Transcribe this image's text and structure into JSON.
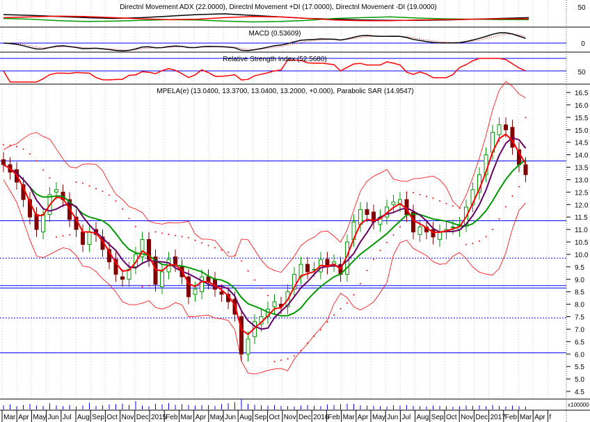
{
  "chart_data": {
    "type": "candlestick",
    "title": "MPELA(e) (13.0400, 13.3700, 13.0400, 13.2000, +0.000), Parabolic SAR (14.9547)",
    "panels": {
      "adx_title": "Directnl Movement ADX (22.0000), Directnl Movement +DI (17.0000), Directnl Movement -DI (19.0000)",
      "macd_title": "MACD (0.53609)",
      "rsi_title": "Relative Strength Index (52.5680)",
      "adx_axis_label": "50",
      "macd_axis_label": "0",
      "rsi_axis_label": "50",
      "volume_axis_label": "x100000"
    },
    "price_ylim": [
      4.5,
      16.5
    ],
    "price_ticks": [
      "16.5",
      "16.0",
      "15.5",
      "15.0",
      "14.5",
      "14.0",
      "13.5",
      "13.0",
      "12.5",
      "12.0",
      "11.5",
      "11.0",
      "10.5",
      "10.0",
      "9.5",
      "9.0",
      "8.5",
      "8.0",
      "7.5",
      "7.0",
      "6.5",
      "6.0",
      "5.5",
      "5.0",
      "4.5"
    ],
    "x_labels": [
      "Mar",
      "Apr",
      "May",
      "Jun",
      "Jul",
      "Aug",
      "Sep",
      "Oct",
      "Nov",
      "Dec",
      "2015",
      "Feb",
      "Mar",
      "Apr",
      "May",
      "Jun",
      "Aug",
      "Sep",
      "Oct",
      "Nov",
      "Dec",
      "2016",
      "Feb",
      "Mar",
      "Apr",
      "May",
      "Jun",
      "Jul",
      "Aug",
      "Sep",
      "Oct",
      "Nov",
      "Dec",
      "2017",
      "Feb",
      "Mar",
      "Apr",
      "f"
    ],
    "closes": [
      13.6,
      13.3,
      12.9,
      12.2,
      11.5,
      11.0,
      11.6,
      12.4,
      12.6,
      12.2,
      11.4,
      11.0,
      10.4,
      10.9,
      10.8,
      10.2,
      9.7,
      9.2,
      9.0,
      9.4,
      10.0,
      10.6,
      9.8,
      8.8,
      9.3,
      9.8,
      9.6,
      9.1,
      8.3,
      8.6,
      9.1,
      8.9,
      8.6,
      8.4,
      8.1,
      7.6,
      6.0,
      6.6,
      7.3,
      7.5,
      7.8,
      8.1,
      7.9,
      8.5,
      9.2,
      9.6,
      9.3,
      9.4,
      9.8,
      9.5,
      9.7,
      9.2,
      10.5,
      11.3,
      11.8,
      11.6,
      11.3,
      11.5,
      11.9,
      12.1,
      12.2,
      11.6,
      10.9,
      11.1,
      10.9,
      10.7,
      10.9,
      11.0,
      11.1,
      11.2,
      11.9,
      12.6,
      13.2,
      14.0,
      14.9,
      15.2,
      15.0,
      14.3,
      13.6,
      13.2
    ],
    "volume": [
      1.5,
      1.8,
      1.2,
      1.6,
      2.0,
      1.4,
      1.3,
      2.2,
      1.5,
      1.2,
      1.6,
      1.1,
      1.4,
      2.4,
      1.3,
      1.5,
      1.8,
      1.9,
      2.1,
      1.6,
      3.0,
      1.4,
      1.2,
      2.1,
      1.8,
      2.3,
      1.7,
      1.9,
      1.6,
      1.4,
      1.5,
      1.6,
      1.3,
      1.9,
      2.2,
      2.6,
      3.8,
      2.0,
      1.7,
      1.5,
      1.4,
      1.6,
      1.3,
      1.2,
      1.1,
      1.4,
      1.6,
      1.3,
      1.2,
      1.8,
      1.6,
      1.9,
      2.1,
      2.0,
      1.5,
      1.4,
      1.3,
      1.2,
      1.1,
      1.5,
      1.4,
      1.6,
      1.3,
      1.2,
      1.1,
      1.4,
      1.3,
      1.2,
      1.0,
      1.2,
      1.4,
      1.3,
      1.5,
      1.2,
      1.6,
      1.3,
      1.1,
      1.4,
      1.2,
      1.0
    ],
    "adx": [
      30,
      28,
      25,
      22,
      20,
      22,
      26,
      30,
      32,
      28,
      24,
      20,
      18,
      16,
      15,
      15,
      16,
      18,
      20,
      22
    ],
    "plus_di": [
      20,
      18,
      14,
      12,
      13,
      15,
      17,
      16,
      13,
      11,
      12,
      15,
      20,
      22,
      24,
      21,
      19,
      18,
      17,
      17
    ],
    "minus_di": [
      22,
      24,
      26,
      25,
      22,
      19,
      17,
      18,
      22,
      25,
      24,
      20,
      16,
      14,
      14,
      16,
      17,
      18,
      19,
      19
    ],
    "hlines_solid": [
      13.75,
      11.35,
      8.75,
      8.65,
      6.05
    ],
    "hlines_dotted": [
      9.85,
      7.45
    ],
    "colors": {
      "up": "#009900",
      "down": "#800000",
      "fast_ma": "#ff0000",
      "mid_ma": "#660066",
      "slow_ma": "#009900",
      "band": "#ff0000",
      "sar": "#ff0000",
      "hline": "#0000ff",
      "volume": "#0000ff"
    }
  }
}
